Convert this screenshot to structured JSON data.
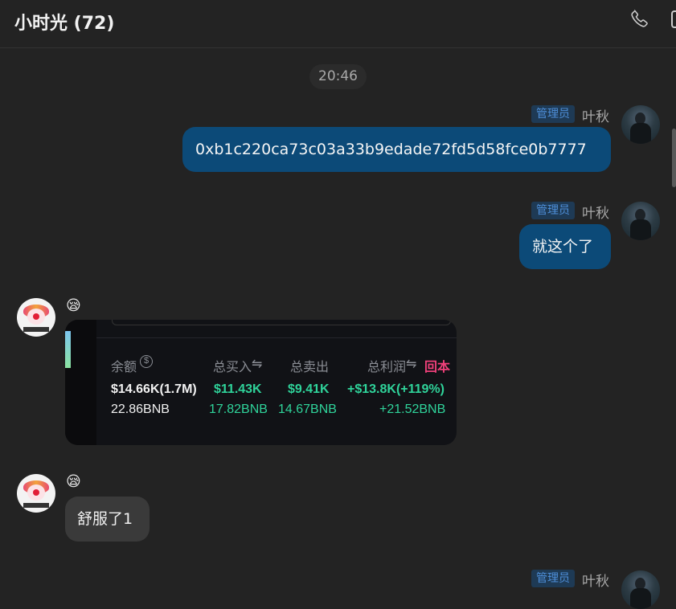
{
  "header": {
    "title": "小时光 (72)"
  },
  "timestamp": "20:46",
  "messages": [
    {
      "badge": "管理员",
      "sender": "叶秋",
      "text": "0xb1c220ca73c03a33b9edade72fd5d58fce0b7777"
    },
    {
      "badge": "管理员",
      "sender": "叶秋",
      "text": "就这个了"
    },
    {
      "emoji": "😪",
      "image": {
        "headers": [
          "余额",
          "总买入",
          "总卖出",
          "总利润",
          "回本"
        ],
        "row1": [
          "$14.66K(1.7M)",
          "$11.43K",
          "$9.41K",
          "+$13.8K(+119%)"
        ],
        "row2": [
          "22.86BNB",
          "17.82BNB",
          "14.67BNB",
          "+21.52BNB"
        ]
      }
    },
    {
      "emoji": "😪",
      "text": "舒服了1"
    },
    {
      "badge": "管理员",
      "sender": "叶秋"
    }
  ]
}
